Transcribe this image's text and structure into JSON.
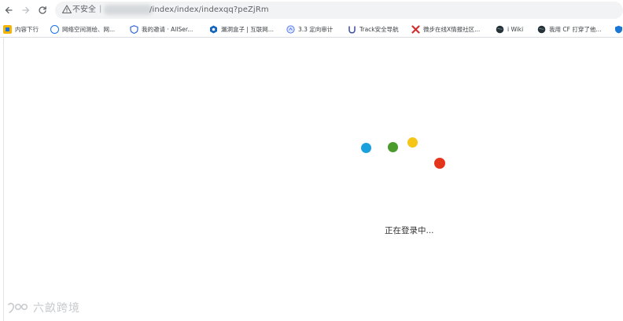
{
  "browser": {
    "omnibox": {
      "security_label": "不安全",
      "separator": "|",
      "url_visible": "/index/index/indexqq?peZjRm"
    },
    "bookmarks": [
      {
        "label": "内容下行",
        "icon": "bookmark-app-icon",
        "color": "#f4b400"
      },
      {
        "label": "网络空间测绘、网...",
        "icon": "globe-badge-icon",
        "color": "#1a73e8"
      },
      {
        "label": "我的邀请 · AllSer...",
        "icon": "shield-icon",
        "color": "#3367d6"
      },
      {
        "label": "漏洞盒子 | 互联网...",
        "icon": "hexagon-icon",
        "color": "#1565c0"
      },
      {
        "label": "3.3 定向审计",
        "icon": "circle-arrow-icon",
        "color": "#5c7cfa"
      },
      {
        "label": "Track安全导航",
        "icon": "u-shield-icon",
        "color": "#3949ab"
      },
      {
        "label": "微步在线X情报社区...",
        "icon": "x-icon",
        "color": "#d32f2f"
      },
      {
        "label": "i Wiki",
        "icon": "globe-dark-icon",
        "color": "#263238"
      },
      {
        "label": "我用 CF 打穿了他...",
        "icon": "globe-dark-icon",
        "color": "#263238"
      },
      {
        "label": "",
        "icon": "shield-blue-icon",
        "color": "#1976d2"
      }
    ]
  },
  "main": {
    "loading_text": "正在登录中...",
    "dots": [
      {
        "name": "blue",
        "color": "#1aa0dc"
      },
      {
        "name": "green",
        "color": "#4a9a2c"
      },
      {
        "name": "yellow",
        "color": "#f5c518"
      },
      {
        "name": "red",
        "color": "#e5341c"
      }
    ]
  },
  "watermark": {
    "text": "六畝跨境"
  }
}
